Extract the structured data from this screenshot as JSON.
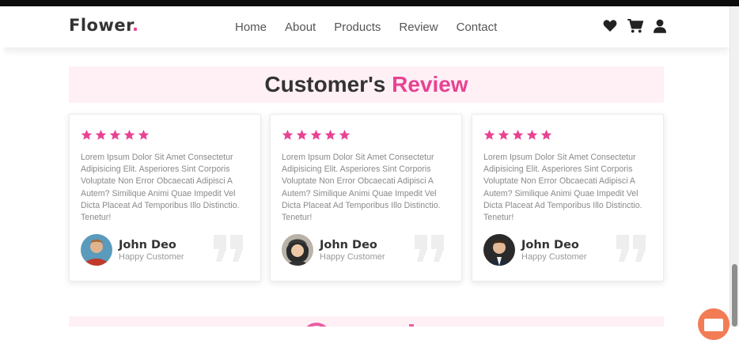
{
  "header": {
    "logo_text": "Flower",
    "logo_dot": ".",
    "nav": [
      "Home",
      "About",
      "Products",
      "Review",
      "Contact"
    ],
    "icons": [
      "heart-icon",
      "cart-icon",
      "user-icon"
    ]
  },
  "section": {
    "title_part1": "Customer's ",
    "title_part2": "Review"
  },
  "reviews": [
    {
      "stars": 5,
      "text": "Lorem Ipsum Dolor Sit Amet Consectetur Adipisicing Elit. Asperiores Sint Corporis Voluptate Non Error Obcaecati Adipisci A Autem? Similique Animi Quae Impedit Vel Dicta Placeat Ad Temporibus Illo Distinctio. Tenetur!",
      "name": "John Deo",
      "role": "Happy Customer"
    },
    {
      "stars": 5,
      "text": "Lorem Ipsum Dolor Sit Amet Consectetur Adipisicing Elit. Asperiores Sint Corporis Voluptate Non Error Obcaecati Adipisci A Autem? Similique Animi Quae Impedit Vel Dicta Placeat Ad Temporibus Illo Distinctio. Tenetur!",
      "name": "John Deo",
      "role": "Happy Customer"
    },
    {
      "stars": 5,
      "text": "Lorem Ipsum Dolor Sit Amet Consectetur Adipisicing Elit. Asperiores Sint Corporis Voluptate Non Error Obcaecati Adipisci A Autem? Similique Animi Quae Impedit Vel Dicta Placeat Ad Temporibus Illo Distinctio. Tenetur!",
      "name": "John Deo",
      "role": "Happy Customer"
    }
  ],
  "colors": {
    "accent": "#e84393",
    "heading": "#333333",
    "title_background": "#fff0f6"
  }
}
